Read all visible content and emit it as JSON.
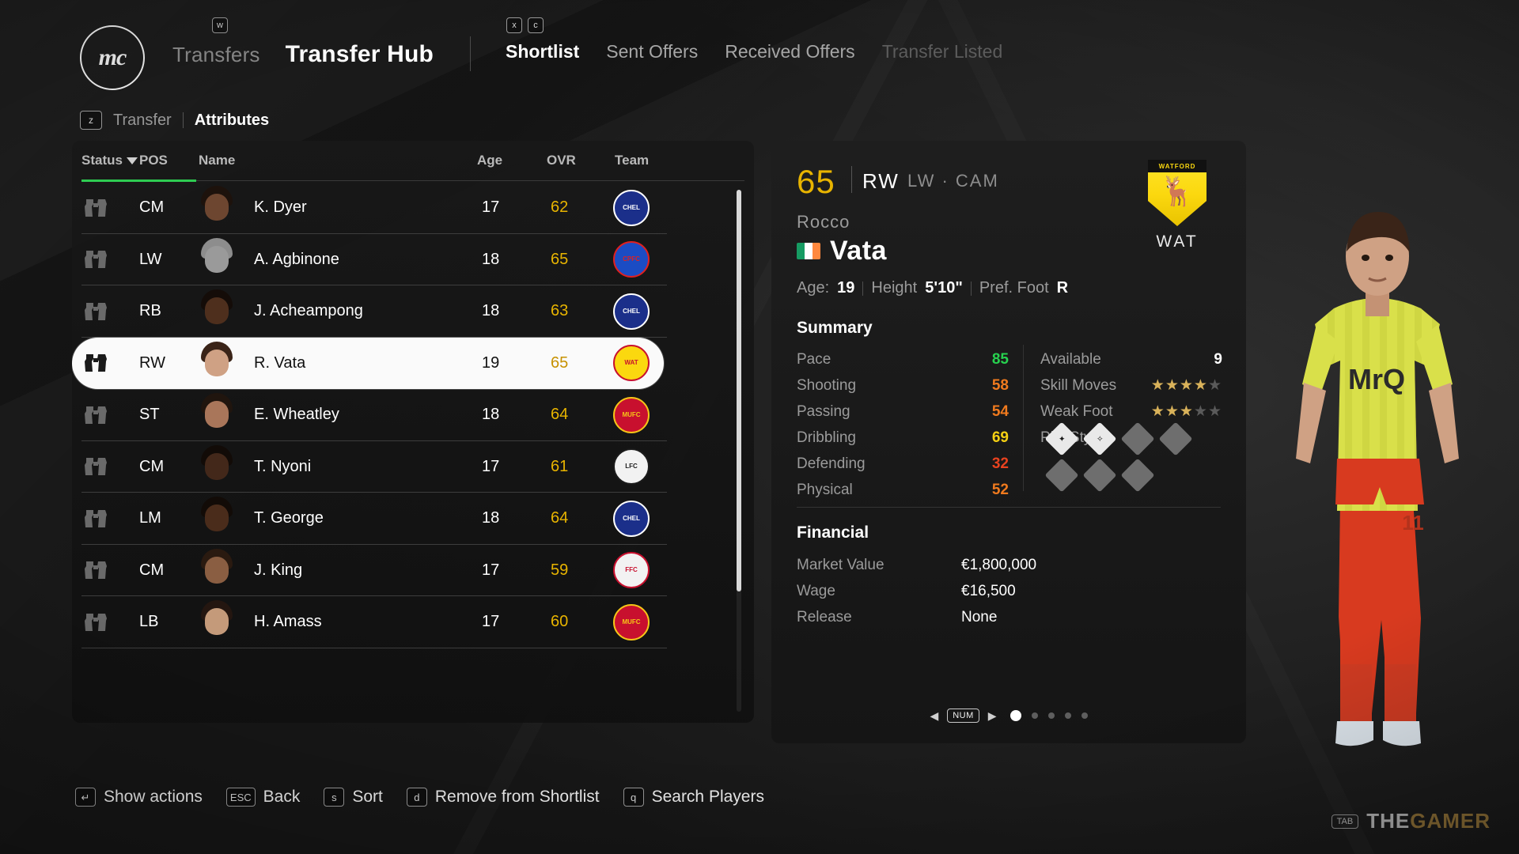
{
  "app": {
    "logo_text": "mc",
    "header": {
      "key_w": "w",
      "key_x": "x",
      "key_c": "c",
      "left_tabs": [
        {
          "label": "Transfers",
          "active": false
        },
        {
          "label": "Transfer Hub",
          "active": true
        }
      ],
      "right_tabs": [
        {
          "label": "Shortlist",
          "state": "active"
        },
        {
          "label": "Sent Offers",
          "state": "normal"
        },
        {
          "label": "Received Offers",
          "state": "normal"
        },
        {
          "label": "Transfer Listed",
          "state": "disabled"
        }
      ]
    },
    "subtabs": {
      "key_z": "z",
      "items": [
        {
          "label": "Transfer",
          "active": false
        },
        {
          "label": "Attributes",
          "active": true
        }
      ]
    }
  },
  "list": {
    "columns": [
      "Status",
      "POS",
      "Name",
      "Age",
      "OVR",
      "Team"
    ],
    "sort_indicator": "descending",
    "rows": [
      {
        "status_icon": "binoculars-icon",
        "pos": "CM",
        "name": "K. Dyer",
        "age": "17",
        "ovr": "62",
        "team": "Chelsea",
        "team_abbr": "CHELSEA",
        "crest_bg": "#1b2f8a",
        "crest_fg": "#ffffff",
        "hair": "#1d120c",
        "skin": "#6d4630",
        "kit": "#1e3fb0",
        "selected": false
      },
      {
        "status_icon": "binoculars-icon",
        "pos": "LW",
        "name": "A. Agbinone",
        "age": "18",
        "ovr": "65",
        "team": "Crystal Palace",
        "team_abbr": "CPFC",
        "crest_bg": "#1b4cc4",
        "crest_fg": "#e02020",
        "hair": "#8d8d8d",
        "skin": "#9a9a9a",
        "kit": "#7a7a7a",
        "selected": false
      },
      {
        "status_icon": "binoculars-icon",
        "pos": "RB",
        "name": "J. Acheampong",
        "age": "18",
        "ovr": "63",
        "team": "Chelsea",
        "team_abbr": "CHELSEA",
        "crest_bg": "#1b2f8a",
        "crest_fg": "#ffffff",
        "hair": "#140c08",
        "skin": "#4e2f1d",
        "kit": "#1e3fb0",
        "selected": false
      },
      {
        "status_icon": "binoculars-icon",
        "pos": "RW",
        "name": "R. Vata",
        "age": "19",
        "ovr": "65",
        "team": "Watford",
        "team_abbr": "WAT",
        "crest_bg": "#fbd80f",
        "crest_fg": "#c8102e",
        "hair": "#3a2418",
        "skin": "#cfa184",
        "kit": "#d8d8d8",
        "selected": true
      },
      {
        "status_icon": "binoculars-icon",
        "pos": "ST",
        "name": "E. Wheatley",
        "age": "18",
        "ovr": "64",
        "team": "Manchester United",
        "team_abbr": "MUFC",
        "crest_bg": "#c8102e",
        "crest_fg": "#f5c518",
        "hair": "#20150e",
        "skin": "#a9765a",
        "kit": "#e2e2e2",
        "selected": false
      },
      {
        "status_icon": "binoculars-icon",
        "pos": "CM",
        "name": "T. Nyoni",
        "age": "17",
        "ovr": "61",
        "team": "Liverpool",
        "team_abbr": "LFC",
        "crest_bg": "#f2f2f2",
        "crest_fg": "#1b1b1b",
        "hair": "#120b07",
        "skin": "#43281a",
        "kit": "#f0f0f0",
        "selected": false
      },
      {
        "status_icon": "binoculars-icon",
        "pos": "LM",
        "name": "T. George",
        "age": "18",
        "ovr": "64",
        "team": "Chelsea",
        "team_abbr": "CHELSEA",
        "crest_bg": "#1b2f8a",
        "crest_fg": "#ffffff",
        "hair": "#120b07",
        "skin": "#4a2c1b",
        "kit": "#1e3fb0",
        "selected": false
      },
      {
        "status_icon": "binoculars-icon",
        "pos": "CM",
        "name": "J. King",
        "age": "17",
        "ovr": "59",
        "team": "Fulham",
        "team_abbr": "FFC",
        "crest_bg": "#f2f2f2",
        "crest_fg": "#c8102e",
        "hair": "#2a1a10",
        "skin": "#8a5e42",
        "kit": "#ededed",
        "selected": false
      },
      {
        "status_icon": "binoculars-icon",
        "pos": "LB",
        "name": "H. Amass",
        "age": "17",
        "ovr": "60",
        "team": "Manchester United",
        "team_abbr": "MUFC",
        "crest_bg": "#c8102e",
        "crest_fg": "#f5c518",
        "hair": "#241610",
        "skin": "#c49a7a",
        "kit": "#e2e2e2",
        "selected": false
      }
    ]
  },
  "detail": {
    "overall": "65",
    "position_primary": "RW",
    "positions_secondary": "LW · CAM",
    "first_name": "Rocco",
    "last_name": "Vata",
    "nationality": "Republic of Ireland",
    "flag_colors": [
      "#169b62",
      "#ffffff",
      "#ff883e"
    ],
    "age_label": "Age:",
    "age_value": "19",
    "height_label": "Height",
    "height_value": "5'10\"",
    "foot_label": "Pref. Foot",
    "foot_value": "R",
    "club_badge_text": "WATFORD",
    "club_abbr": "WAT",
    "summary_title": "Summary",
    "stats": [
      {
        "label": "Pace",
        "value": "85",
        "color": "#27d14f"
      },
      {
        "label": "Shooting",
        "value": "58",
        "color": "#f07a1e"
      },
      {
        "label": "Passing",
        "value": "54",
        "color": "#f07a1e"
      },
      {
        "label": "Dribbling",
        "value": "69",
        "color": "#f5d013"
      },
      {
        "label": "Defending",
        "value": "32",
        "color": "#e8421f"
      },
      {
        "label": "Physical",
        "value": "52",
        "color": "#f07a1e"
      }
    ],
    "meta": [
      {
        "label": "Available",
        "value": "9",
        "type": "text"
      },
      {
        "label": "Skill Moves",
        "value": "4",
        "type": "stars",
        "max": "5"
      },
      {
        "label": "Weak Foot",
        "value": "3",
        "type": "stars",
        "max": "5"
      },
      {
        "label": "PlayStyles",
        "value": "",
        "type": "playstyles"
      }
    ],
    "playstyles": [
      {
        "filled": true,
        "glyph": "✦"
      },
      {
        "filled": true,
        "glyph": "✧"
      },
      {
        "filled": false,
        "glyph": ""
      },
      {
        "filled": false,
        "glyph": ""
      },
      {
        "filled": false,
        "glyph": ""
      },
      {
        "filled": false,
        "glyph": ""
      },
      {
        "filled": false,
        "glyph": ""
      }
    ],
    "financial_title": "Financial",
    "financial": [
      {
        "label": "Market Value",
        "value": "€1,800,000"
      },
      {
        "label": "Wage",
        "value": "€16,500"
      },
      {
        "label": "Release",
        "value": "None"
      }
    ],
    "pager": {
      "left_arrow": "◀",
      "right_arrow": "▶",
      "num_key": "NUM",
      "pages": 5,
      "active_page": 1
    }
  },
  "actionbar": [
    {
      "key": "↵",
      "label": "Show actions"
    },
    {
      "key": "ESC",
      "label": "Back"
    },
    {
      "key": "s",
      "label": "Sort"
    },
    {
      "key": "d",
      "label": "Remove from Shortlist"
    },
    {
      "key": "q",
      "label": "Search Players"
    }
  ],
  "watermark": {
    "key": "TAB",
    "text_a": "THE",
    "text_b": "GAMER"
  }
}
